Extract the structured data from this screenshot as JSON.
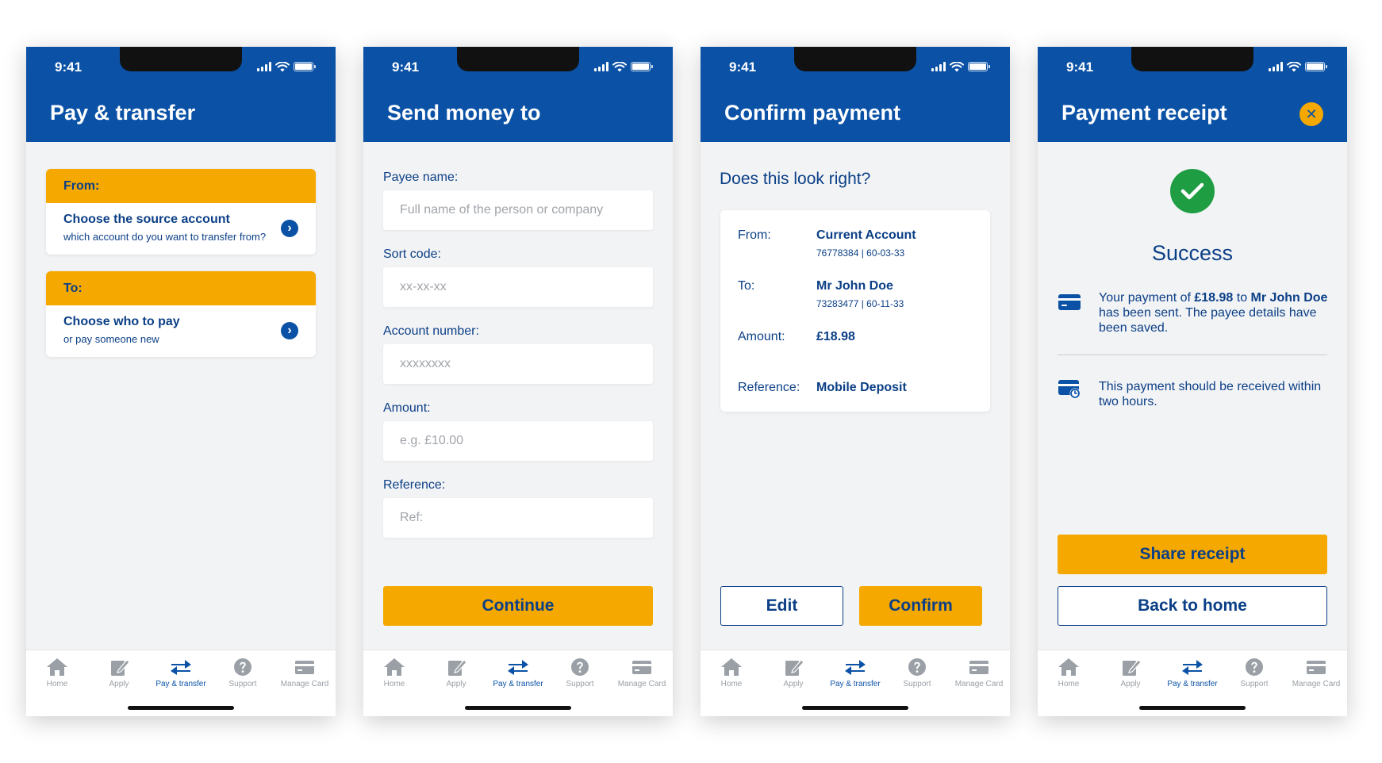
{
  "status_bar": {
    "time": "9:41"
  },
  "tabbar": {
    "items": [
      {
        "label": "Home",
        "icon": "home-icon"
      },
      {
        "label": "Apply",
        "icon": "edit-icon"
      },
      {
        "label": "Pay & transfer",
        "icon": "transfer-icon"
      },
      {
        "label": "Support",
        "icon": "help-icon"
      },
      {
        "label": "Manage Card",
        "icon": "card-icon"
      }
    ],
    "active_index": 2
  },
  "screen1": {
    "title": "Pay & transfer",
    "from": {
      "header": "From:",
      "title": "Choose the source account",
      "subtitle": "which account do you want to transfer from?"
    },
    "to": {
      "header": "To:",
      "title": "Choose who to pay",
      "subtitle": "or pay someone new"
    }
  },
  "screen2": {
    "title": "Send money to",
    "fields": [
      {
        "label": "Payee name:",
        "placeholder": "Full name of the person or company"
      },
      {
        "label": "Sort code:",
        "placeholder": "xx-xx-xx"
      },
      {
        "label": "Account number:",
        "placeholder": "xxxxxxxx"
      },
      {
        "label": "Amount:",
        "placeholder": "e.g. £10.00"
      },
      {
        "label": "Reference:",
        "placeholder": "Ref:"
      }
    ],
    "continue_label": "Continue"
  },
  "screen3": {
    "title": "Confirm payment",
    "question": "Does this look right?",
    "from": {
      "label": "From:",
      "value": "Current Account",
      "detail": "76778384 | 60-03-33"
    },
    "to": {
      "label": "To:",
      "value": "Mr John Doe",
      "detail": "73283477 | 60-11-33"
    },
    "amount": {
      "label": "Amount:",
      "value": "£18.98"
    },
    "reference": {
      "label": "Reference:",
      "value": "Mobile Deposit"
    },
    "edit_label": "Edit",
    "confirm_label": "Confirm"
  },
  "screen4": {
    "title": "Payment receipt",
    "success": "Success",
    "msg1": {
      "pre": "Your payment of ",
      "amount": "£18.98",
      "mid": " to ",
      "payee": "Mr John Doe",
      "post": " has been sent. The payee details have been saved."
    },
    "msg2": "This payment should be received within two hours.",
    "share_label": "Share receipt",
    "back_label": "Back to home"
  },
  "colors": {
    "brand_blue": "#0b52a6",
    "accent_yellow": "#f5a800",
    "success_green": "#1f9d43",
    "text_navy": "#0b3f86"
  }
}
